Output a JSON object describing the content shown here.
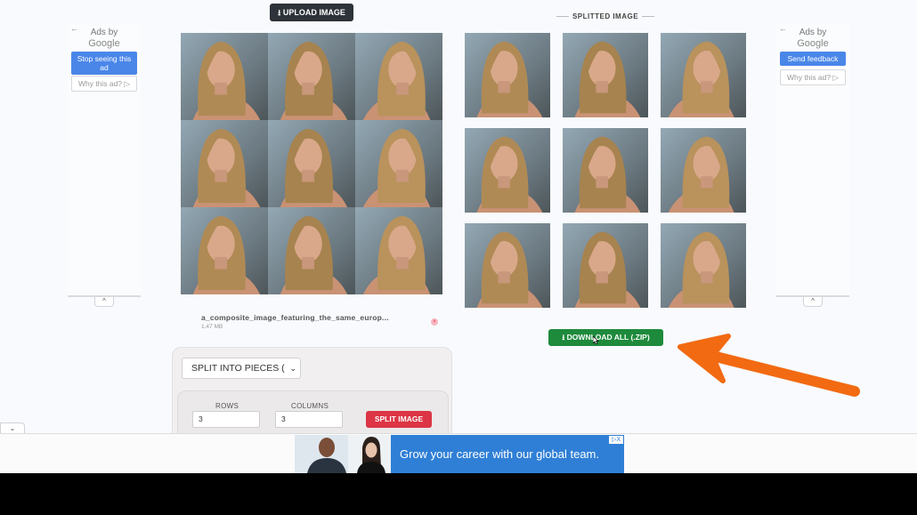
{
  "upload_button": {
    "label": "UPLOAD IMAGE",
    "icon": "upload-icon"
  },
  "left_ad": {
    "back": "←",
    "ads_by": "Ads by",
    "google": "Google",
    "primary_button": "Stop seeing this ad",
    "secondary_button": "Why this ad? ▷",
    "collapse": "^"
  },
  "right_ad": {
    "back": "←",
    "ads_by": "Ads by",
    "google": "Google",
    "primary_button": "Send feedback",
    "secondary_button": "Why this ad? ▷",
    "collapse": "^"
  },
  "source_file": {
    "name": "a_composite_image_featuring_the_same_europ...",
    "size": "1.47 MB",
    "remove": "×"
  },
  "split_panel": {
    "mode_select": "SPLIT INTO PIECES (",
    "rows_label": "ROWS",
    "rows_value": "3",
    "columns_label": "COLUMNS",
    "columns_value": "3",
    "split_button": "SPLIT IMAGE"
  },
  "result": {
    "heading": "SPLITTED IMAGE",
    "download_button": "DOWNLOAD ALL (.ZIP)",
    "download_icon": "download-icon"
  },
  "bottom_ad": {
    "toggle": "⌄",
    "text": "Grow your career with our global team.",
    "choices": "▷X"
  },
  "colors": {
    "upload_bg": "#2d3339",
    "split_red": "#dc3545",
    "download_green": "#1e8a3c",
    "arrow_orange": "#f26a12",
    "ad_blue": "#4a86e8",
    "banner_blue": "#2f7fd6"
  }
}
